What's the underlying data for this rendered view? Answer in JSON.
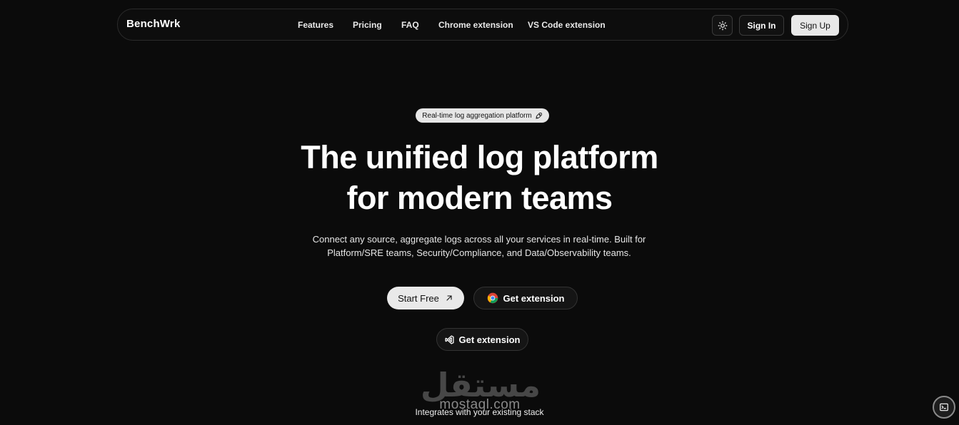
{
  "nav": {
    "logo": "BenchWrk",
    "links": [
      "Features",
      "Pricing",
      "FAQ",
      "Chrome extension",
      "VS Code extension"
    ],
    "sign_in": "Sign In",
    "sign_up": "Sign Up"
  },
  "hero": {
    "badge": "Real-time log aggregation platform",
    "title_line1": "The unified log platform",
    "title_line2": "for modern teams",
    "subtitle_line1": "Connect any source, aggregate logs across all your services in real-time. Built for",
    "subtitle_line2": "Platform/SRE teams, Security/Compliance, and Data/Observability teams.",
    "start_label": "Start Free",
    "chrome_ext_label": "Get extension",
    "vscode_ext_label": "Get extension"
  },
  "watermark": {
    "arabic": "مستقل",
    "latin": "mostaql.com"
  },
  "integrates_text": "Integrates with your existing stack",
  "colors": {
    "background": "#0b0b0b",
    "primary_button": "#e9e9e9",
    "secondary_button": "#151515"
  }
}
